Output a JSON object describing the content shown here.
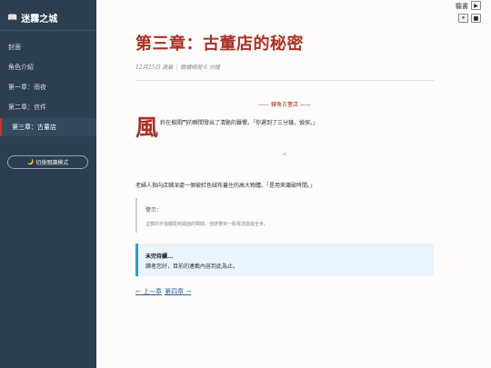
{
  "sidebar": {
    "brand": "迷霧之城",
    "brand_icon": "book-icon",
    "items": [
      {
        "label": "封面"
      },
      {
        "label": "角色介紹"
      },
      {
        "label": "第一章：雨夜"
      },
      {
        "label": "第二章：信件"
      },
      {
        "label": "第三章：古董店",
        "active": true
      }
    ],
    "theme_toggle": "切換閱讀模式",
    "theme_icon": "moon-icon"
  },
  "controls": {
    "speed_label": "聽書",
    "play_symbol": "▶",
    "pause_symbol": "⏸",
    "stop_symbol": "■"
  },
  "chapter": {
    "title": "第三章：古董店的秘密",
    "date": "12月25日 清晨",
    "reading_time": "閱讀時間 6 分鐘",
    "section_heading": "—— 轉角古董店 ——",
    "dropcap": "風",
    "para1": "鈴在推開門的瞬間發出了清脆的聲響。「你遲到了三分鐘，偵探。」",
    "divider": "＊",
    "para2": "老婦人指向店鋪深處一個被紅色絨布蓋住的高大物體。「是用來識破時間。」"
  },
  "warning": {
    "title": "警示：",
    "text": "這雙的手指觸碰到絨面的瞬間，他感覺到一股電流竄遍全身。"
  },
  "notice": {
    "title": "未完待續...",
    "text": "讀者您好，目前的連載內容到此為止。"
  },
  "pager": {
    "prev": "← 上一章",
    "next": "第四章 →"
  },
  "colors": {
    "sidebar_bg": "#2c3e50",
    "accent": "#a93226",
    "notice_border": "#3498db"
  }
}
